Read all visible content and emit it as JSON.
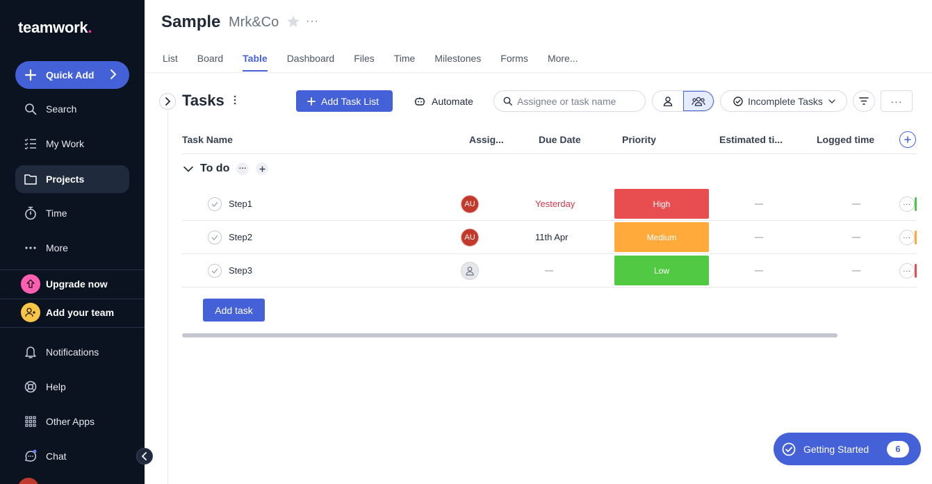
{
  "sidebar": {
    "logo": {
      "text": "teamwork",
      "dot": "."
    },
    "quick_add_label": "Quick Add",
    "items": [
      {
        "label": "Search",
        "icon": "search-icon"
      },
      {
        "label": "My Work",
        "icon": "list-check-icon"
      },
      {
        "label": "Projects",
        "icon": "folder-icon",
        "active": true
      },
      {
        "label": "Time",
        "icon": "stopwatch-icon"
      },
      {
        "label": "More",
        "icon": "dots-icon"
      }
    ],
    "upgrade_label": "Upgrade now",
    "add_team_label": "Add your team",
    "bottom_items": [
      {
        "label": "Notifications",
        "icon": "bell-icon"
      },
      {
        "label": "Help",
        "icon": "lifebuoy-icon"
      },
      {
        "label": "Other Apps",
        "icon": "grid-icon"
      },
      {
        "label": "Chat",
        "icon": "chat-icon"
      }
    ]
  },
  "header": {
    "project_title": "Sample",
    "company": "Mrk&Co",
    "tabs": [
      "List",
      "Board",
      "Table",
      "Dashboard",
      "Files",
      "Time",
      "Milestones",
      "Forms",
      "More..."
    ],
    "active_tab": "Table"
  },
  "toolbar": {
    "title": "Tasks",
    "add_task_list_label": "Add Task List",
    "automate_label": "Automate",
    "search_placeholder": "Assignee or task name",
    "filter_label": "Incomplete Tasks",
    "more_label": "···"
  },
  "table": {
    "columns": [
      "Task Name",
      "Assig...",
      "Due Date",
      "Priority",
      "Estimated ti...",
      "Logged time"
    ],
    "group": {
      "name": "To do"
    },
    "rows": [
      {
        "name": "Step1",
        "assignee": "AU",
        "due": "Yesterday",
        "due_overdue": true,
        "priority": "High",
        "priority_color": "#e84e4f",
        "edge_color": "#4fc84a"
      },
      {
        "name": "Step2",
        "assignee": "AU",
        "due": "11th Apr",
        "due_overdue": false,
        "priority": "Medium",
        "priority_color": "#ffaa3b",
        "edge_color": "#ffaa3b"
      },
      {
        "name": "Step3",
        "assignee": "",
        "due": "",
        "due_overdue": false,
        "priority": "Low",
        "priority_color": "#52c943",
        "edge_color": "#e84e4f"
      }
    ],
    "add_task_label": "Add task"
  },
  "getting_started": {
    "label": "Getting Started",
    "count": "6"
  },
  "colors": {
    "accent": "#4461d7",
    "sidebar_bg": "#0b1220",
    "upgrade": "#ff5fb0",
    "team": "#f7c548"
  }
}
